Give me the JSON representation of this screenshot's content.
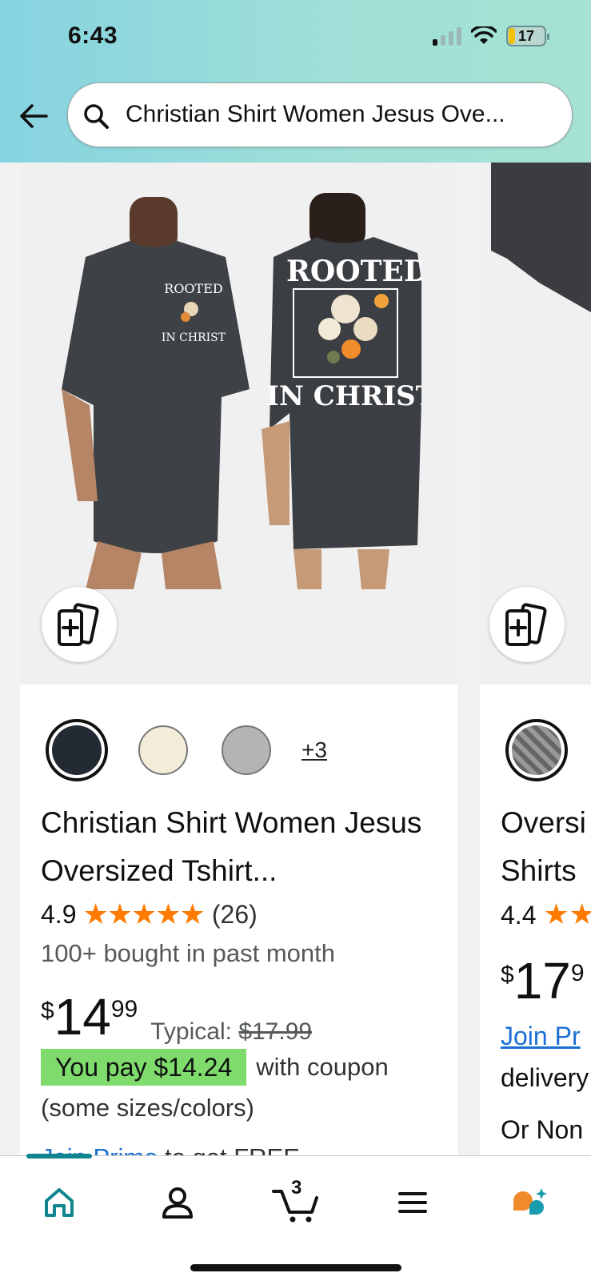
{
  "status_bar": {
    "time": "6:43",
    "battery": "17"
  },
  "search": {
    "query": "Christian Shirt Women Jesus Ove..."
  },
  "product1": {
    "more_colors": "+3",
    "title": "Christian Shirt Women Jesus Oversized Tshirt...",
    "rating": "4.9",
    "stars": "★★★★★",
    "review_count": "(26)",
    "bought": "100+ bought in past month",
    "price_symbol": "$",
    "price_whole": "14",
    "price_fraction": "99",
    "typical_label": "Typical:",
    "typical_price": "$17.99",
    "coupon_badge": "You pay $14.24",
    "coupon_tail": "with coupon",
    "sizes_note": "(some sizes/colors)",
    "join_link": "Join Prime",
    "join_tail": " to get FREE",
    "shirt_print_top": "ROOTED",
    "shirt_print_bottom": "IN CHRIST",
    "swatch_colors": [
      "#232a33",
      "#f3ecd9",
      "#b4b4b4"
    ]
  },
  "product2": {
    "title_line1": "Oversi",
    "title_line2": "Shirts",
    "rating": "4.4",
    "stars": "★★",
    "price_symbol": "$",
    "price_whole": "17",
    "price_fraction": "9",
    "join_link": "Join Pr",
    "delivery": "delivery",
    "or_non": "Or Non"
  },
  "bottom_nav": {
    "items": [
      "home-icon",
      "account-icon",
      "cart-icon",
      "menu-icon",
      "rufus-icon"
    ],
    "cart_count": "3"
  },
  "colors": {
    "accent": "#10858f",
    "star": "#ff7a00",
    "coupon": "#7fdc6c",
    "link": "#1a6fd4"
  }
}
